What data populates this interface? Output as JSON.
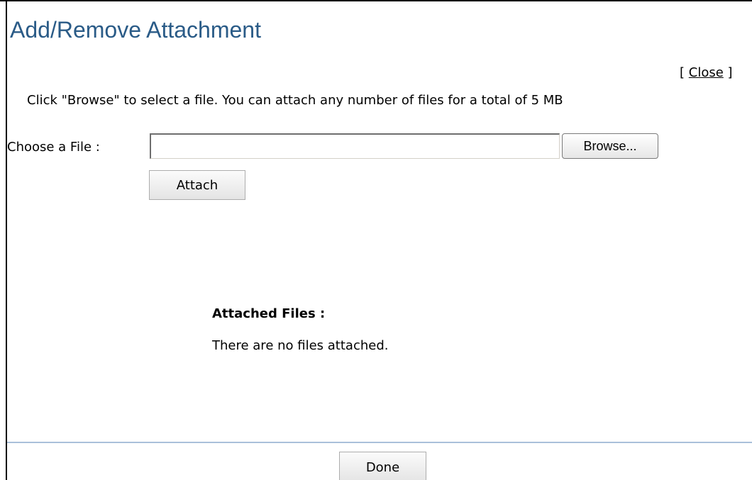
{
  "dialog": {
    "title": "Add/Remove Attachment",
    "close_link": {
      "open_bracket": "[",
      "label": "Close",
      "close_bracket": "]"
    },
    "instructions": "Click \"Browse\" to select a file. You can attach any number of files for a total of 5 MB",
    "file_chooser": {
      "label": "Choose a File :",
      "value": "",
      "browse_label": "Browse..."
    },
    "attach_label": "Attach",
    "attached_files": {
      "title": "Attached Files :",
      "empty_message": "There are no files attached."
    },
    "done_label": "Done"
  },
  "colors": {
    "title": "#2a5b87",
    "divider": "#a9c0da"
  }
}
